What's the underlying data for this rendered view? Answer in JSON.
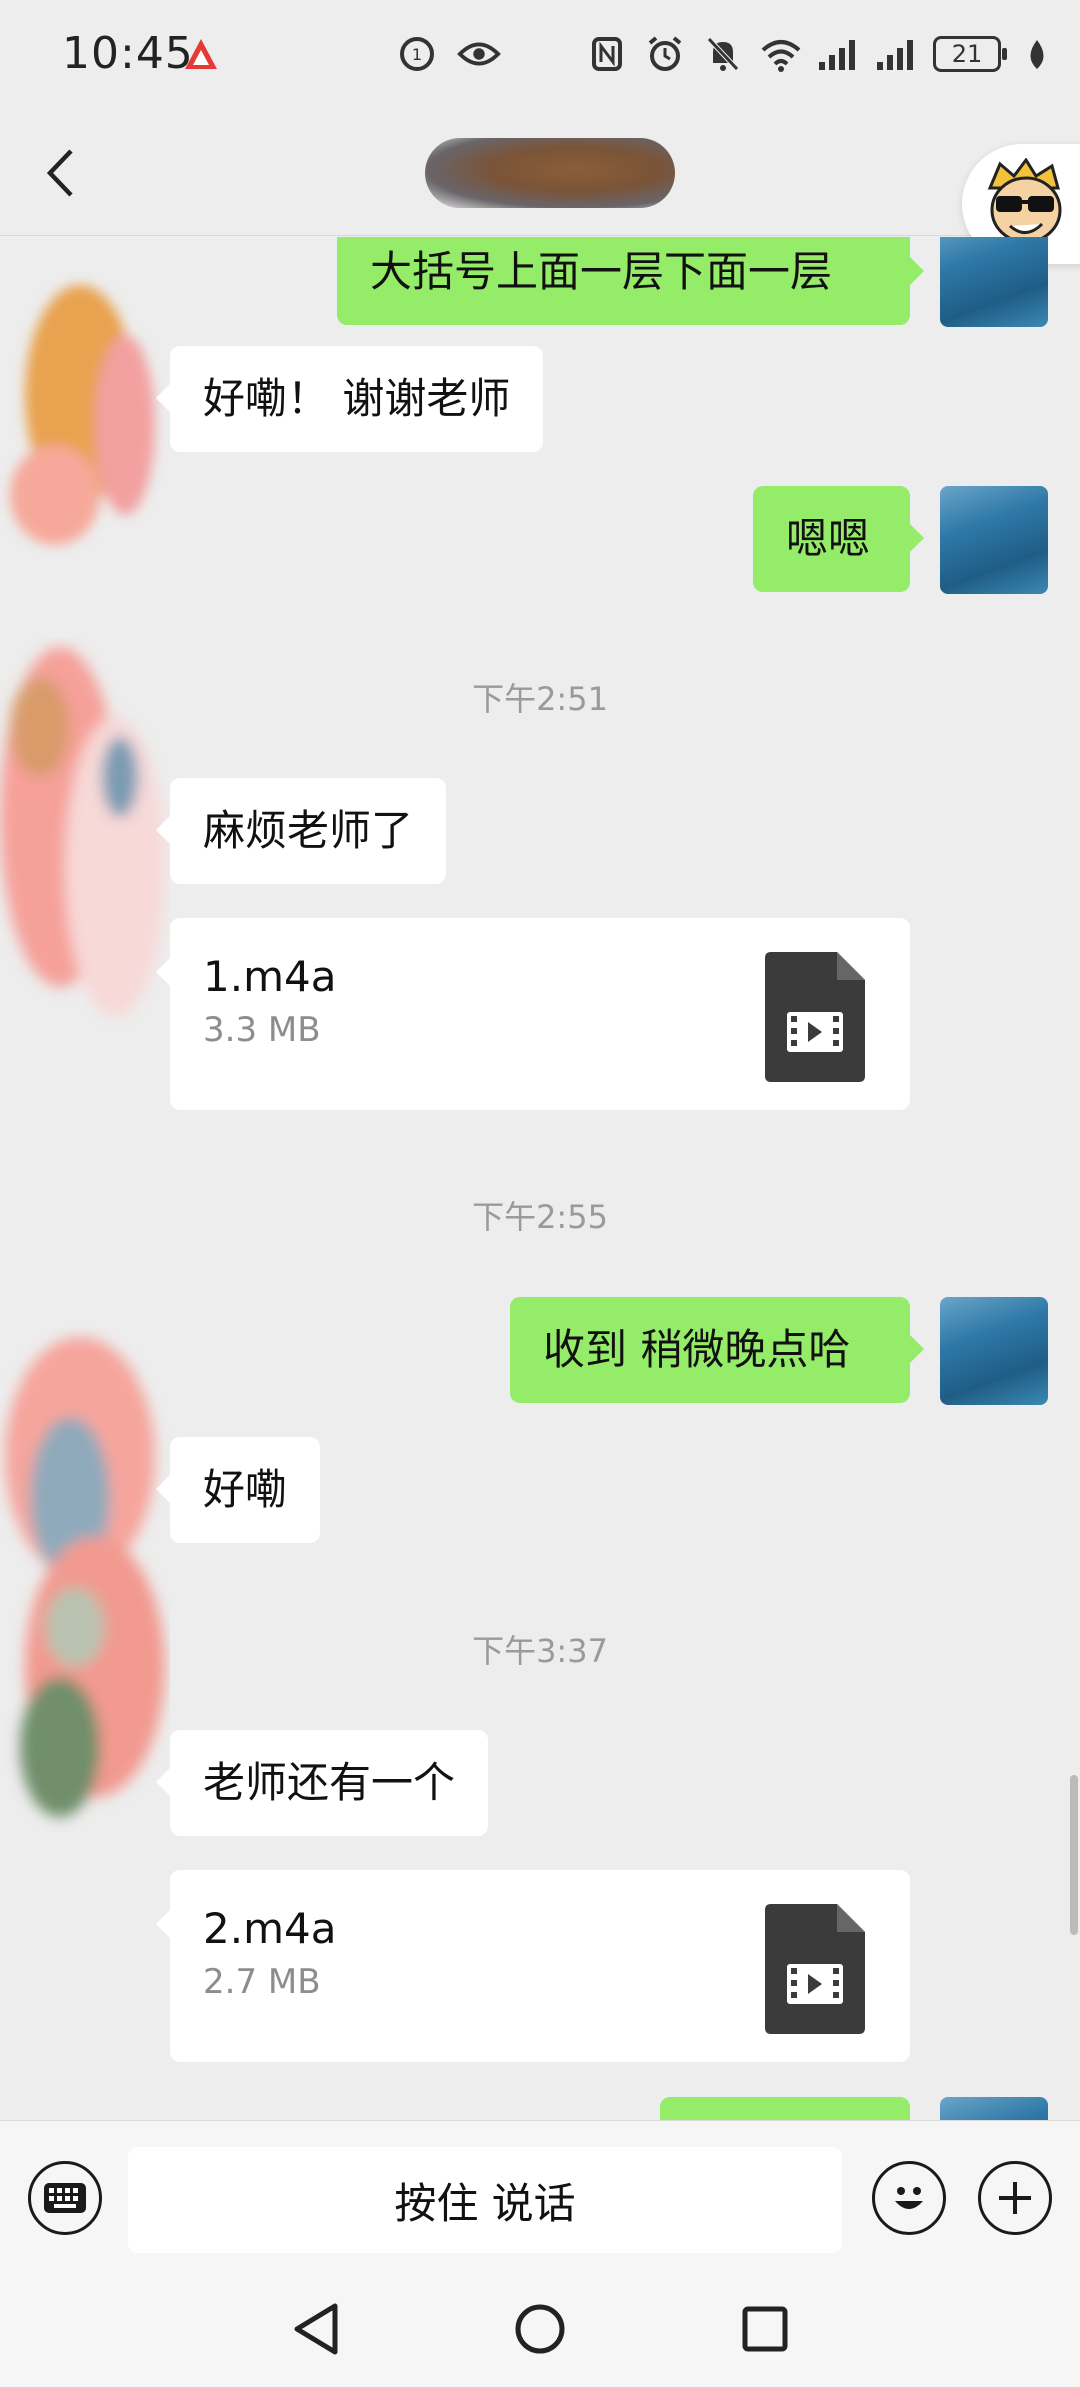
{
  "status_bar": {
    "time": "10:45",
    "battery": "21"
  },
  "header": {
    "back_icon": "chevron-left-icon"
  },
  "messages": [
    {
      "side": "out",
      "text": "大括号上面一层下面一层"
    },
    {
      "side": "in",
      "text": "好嘞！ 谢谢老师"
    },
    {
      "side": "out",
      "text": "嗯嗯"
    },
    {
      "timestamp": "下午2:51"
    },
    {
      "side": "in",
      "text": "麻烦老师了"
    },
    {
      "side": "in",
      "file": {
        "name": "1.m4a",
        "size": "3.3 MB"
      }
    },
    {
      "timestamp": "下午2:55"
    },
    {
      "side": "out",
      "text": "收到 稍微晚点哈"
    },
    {
      "side": "in",
      "text": "好嘞"
    },
    {
      "timestamp": "下午3:37"
    },
    {
      "side": "in",
      "text": "老师还有一个"
    },
    {
      "side": "in",
      "file": {
        "name": "2.m4a",
        "size": "2.7 MB"
      }
    }
  ],
  "input_bar": {
    "hold_to_talk": "按住 说话"
  },
  "colors": {
    "out_bubble": "#95ec69",
    "in_bubble": "#ffffff",
    "background": "#ededed"
  }
}
